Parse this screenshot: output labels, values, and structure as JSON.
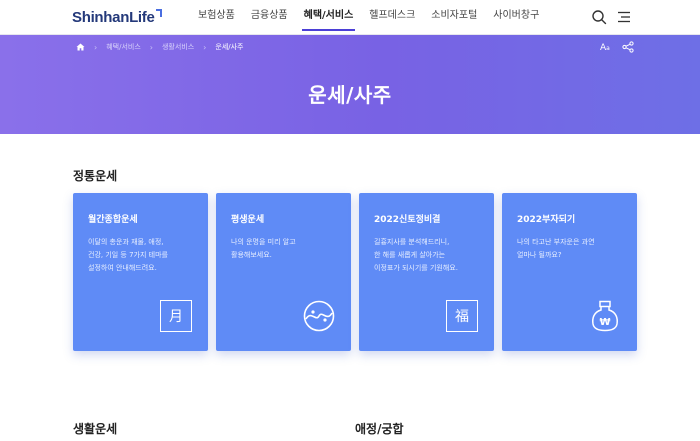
{
  "header": {
    "logo_text": "ShinhanLife",
    "nav": [
      {
        "label": "보험상품",
        "active": false
      },
      {
        "label": "금융상품",
        "active": false
      },
      {
        "label": "혜택/서비스",
        "active": true
      },
      {
        "label": "헬프데스크",
        "active": false
      },
      {
        "label": "소비자포털",
        "active": false
      },
      {
        "label": "사이버창구",
        "active": false
      }
    ],
    "icons": [
      "search-icon",
      "menu-icon"
    ]
  },
  "hero": {
    "breadcrumbs": [
      "혜택/서비스",
      "생활서비스",
      "운세/사주"
    ],
    "home_icon": "home-icon",
    "title": "운세/사주",
    "font_size_label": "A",
    "font_size_sub": "a",
    "share_icon": "share-icon"
  },
  "sections": {
    "traditional": {
      "title": "정통운세",
      "cards": [
        {
          "title": "월간종합운세",
          "desc": "이달의 총운과 재물, 애정,\n건강, 기일 등 7가지 테마를\n설정하여 안내해드려요.",
          "icon": "moon-character-icon",
          "glyph": "月"
        },
        {
          "title": "평생운세",
          "desc": "나의 운명을 미리 알고\n활용해보세요.",
          "icon": "yin-yang-icon",
          "glyph": ""
        },
        {
          "title": "2022신토정비결",
          "desc": "길흉지사를 분석해드리니,\n한 해를 새롭게 살아가는\n이정표가 되시기를 기원해요.",
          "icon": "fortune-character-icon",
          "glyph": "福"
        },
        {
          "title": "2022부자되기",
          "desc": "나의 타고난 부자운은 과연\n얼마나 될까요?",
          "icon": "money-bag-icon",
          "glyph": "₩"
        }
      ]
    },
    "life": {
      "title": "생활운세"
    },
    "love": {
      "title": "애정/궁합"
    }
  },
  "colors": {
    "brand_navy": "#24397a",
    "hero_purple": "#7862e4",
    "card_blue": "#5f8bf6",
    "nav_active_underline": "#4b3fd6"
  }
}
